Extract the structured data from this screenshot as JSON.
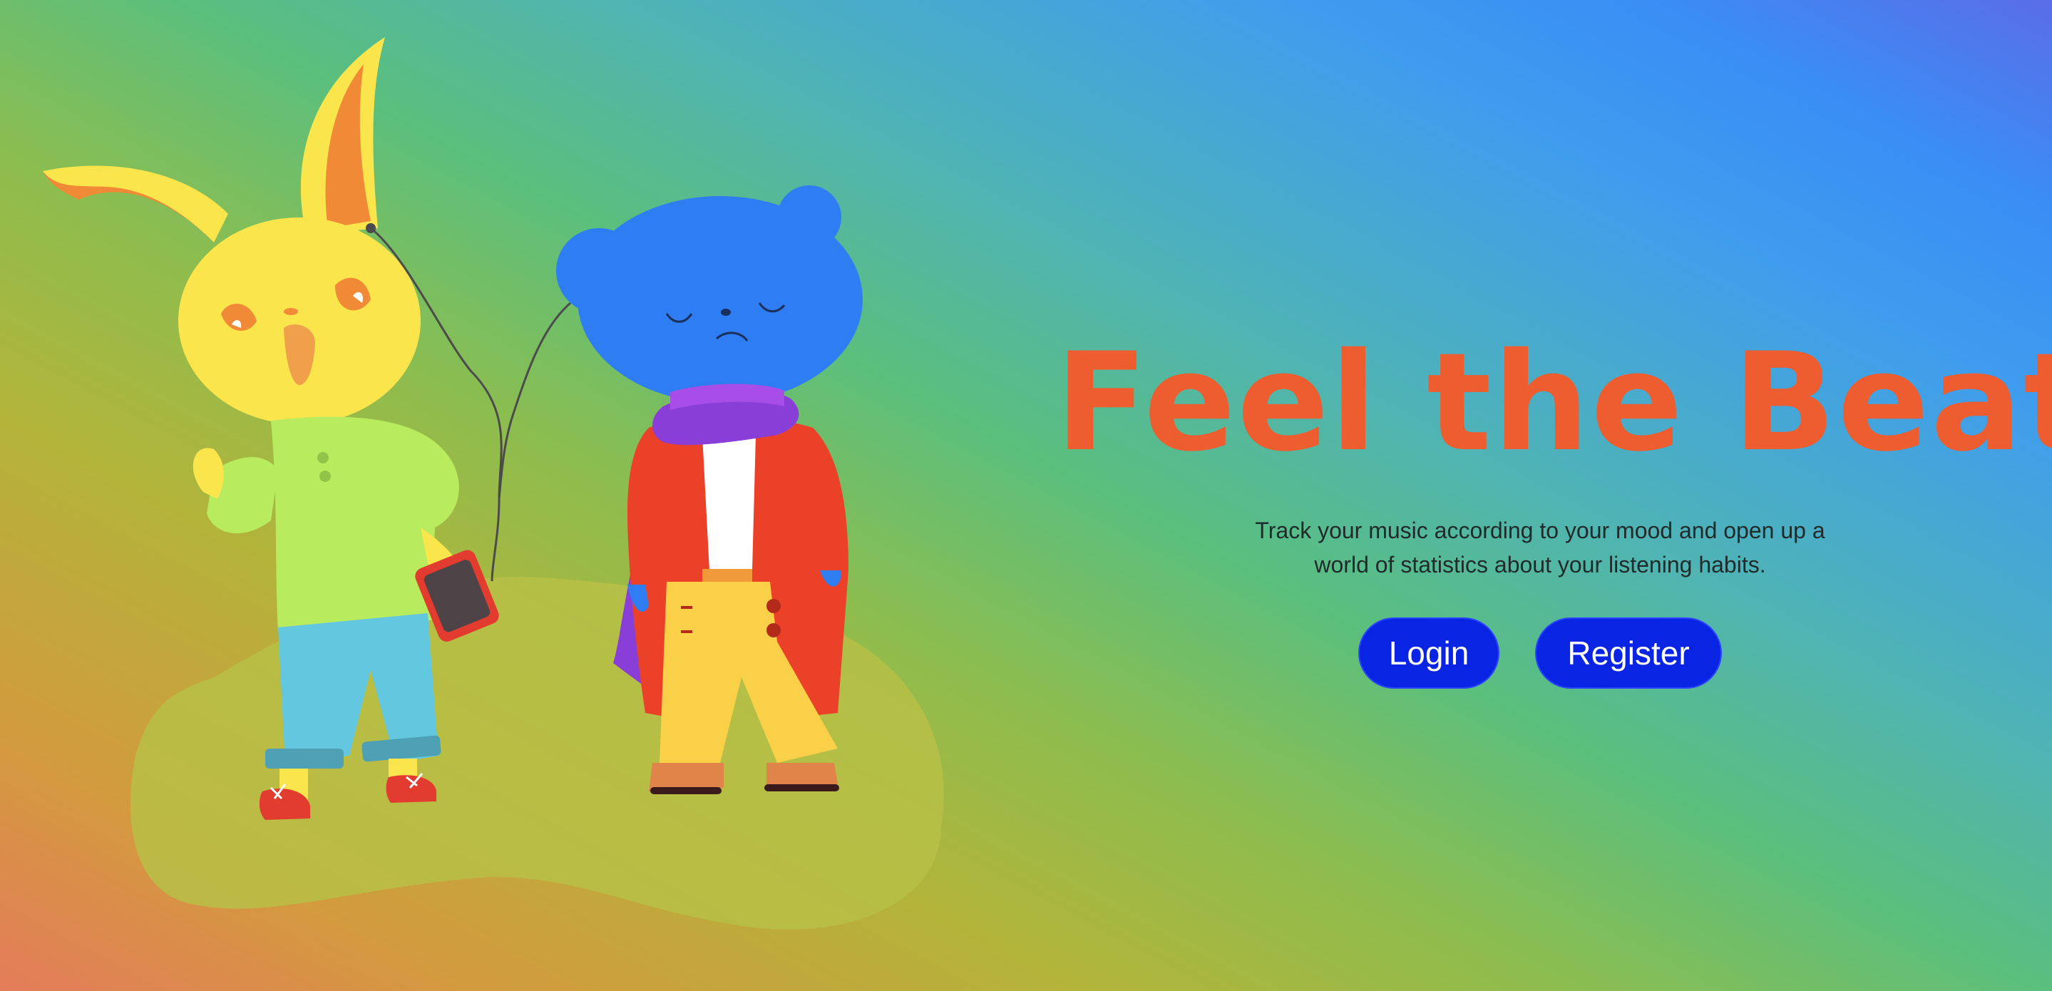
{
  "hero": {
    "title": "Feel the Beat!",
    "tagline": "Track your music according to your mood and open up a world of statistics about your listening habits."
  },
  "actions": {
    "login_label": "Login",
    "register_label": "Register"
  },
  "illustration": {
    "characters": [
      "yellow-rabbit-with-phone",
      "blue-bear-with-scarf"
    ]
  },
  "colors": {
    "title": "#ee5d2f",
    "button": "#0a24e4",
    "button_text": "#ffffff"
  }
}
